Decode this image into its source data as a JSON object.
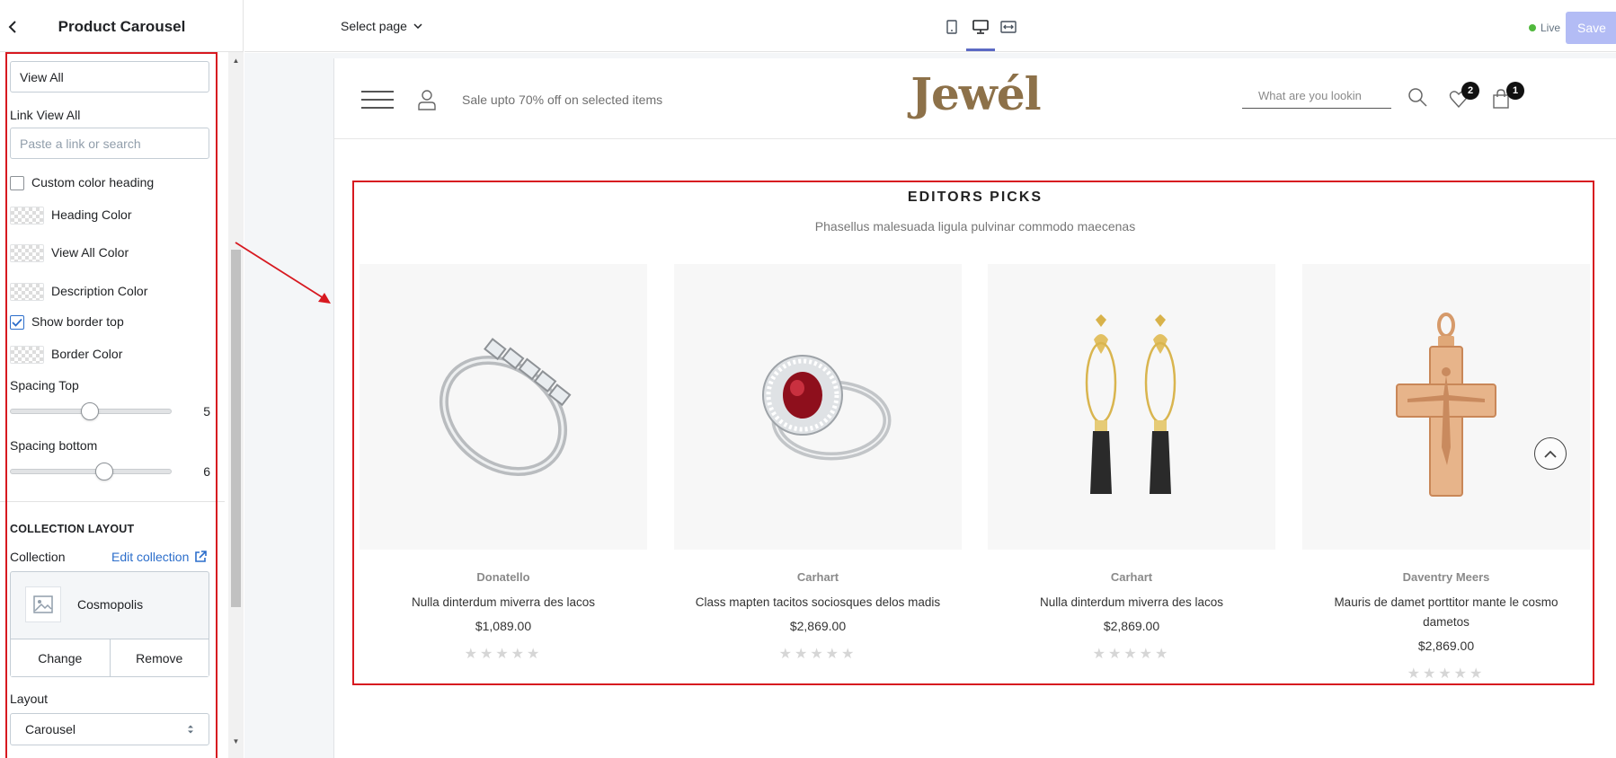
{
  "sidebar": {
    "title": "Product Carousel",
    "view_all_value": "View All",
    "link_view_all_label": "Link View All",
    "link_view_all_placeholder": "Paste a link or search",
    "custom_color_heading_label": "Custom color heading",
    "custom_color_heading_checked": false,
    "heading_color_label": "Heading Color",
    "view_all_color_label": "View All Color",
    "description_color_label": "Description Color",
    "show_border_top_label": "Show border top",
    "show_border_top_checked": true,
    "border_color_label": "Border Color",
    "spacing_top_label": "Spacing Top",
    "spacing_top_value": "5",
    "spacing_bottom_label": "Spacing bottom",
    "spacing_bottom_value": "6",
    "collection_layout_heading": "COLLECTION LAYOUT",
    "collection_label": "Collection",
    "edit_collection_label": "Edit collection",
    "collection_name": "Cosmopolis",
    "change_label": "Change",
    "remove_label": "Remove",
    "layout_label": "Layout",
    "layout_value": "Carousel"
  },
  "toolbar": {
    "select_page_label": "Select page",
    "live_label": "Live",
    "save_label": "Save",
    "active_device": "desktop"
  },
  "store": {
    "promo_text": "Sale upto 70% off on selected items",
    "logo": "Jewél",
    "search_placeholder": "What are you lookin",
    "wishlist_count": "2",
    "cart_count": "1"
  },
  "section": {
    "title": "EDITORS PICKS",
    "description": "Phasellus malesuada ligula pulvinar commodo maecenas",
    "products": [
      {
        "vendor": "Donatello",
        "title": "Nulla dinterdum miverra des lacos",
        "price": "$1,089.00",
        "stars": "★★★★★",
        "image": "silver-baguette-ring"
      },
      {
        "vendor": "Carhart",
        "title": "Class mapten tacitos sociosques delos madis",
        "price": "$2,869.00",
        "stars": "★★★★★",
        "image": "ruby-diamond-ring"
      },
      {
        "vendor": "Carhart",
        "title": "Nulla dinterdum miverra des lacos",
        "price": "$2,869.00",
        "stars": "★★★★★",
        "image": "gold-tassel-earrings"
      },
      {
        "vendor": "Daventry Meers",
        "title": "Mauris de damet porttitor mante le cosmo dametos",
        "price": "$2,869.00",
        "stars": "★★★★★",
        "image": "gold-crucifix-pendant"
      }
    ]
  },
  "colors": {
    "annotation_red": "#d71920",
    "brand_gold": "#8d7149",
    "save_disabled": "#b3bcf5",
    "live_green": "#50b83c",
    "link_blue": "#2c6ecb"
  }
}
